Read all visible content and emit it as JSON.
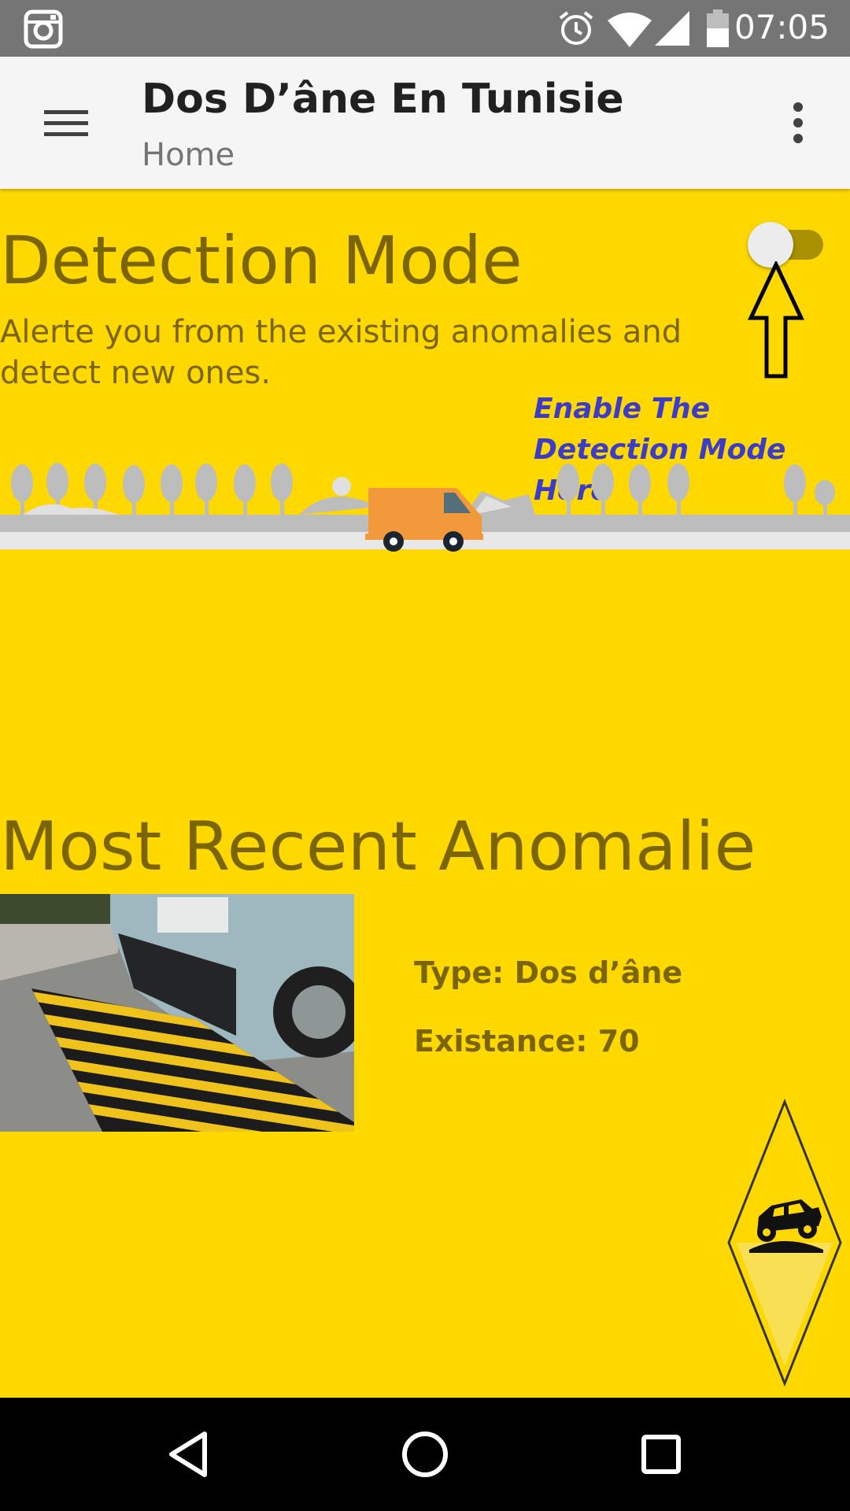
{
  "status_bar": {
    "time": "07:05",
    "icons": [
      "instagram-icon",
      "alarm-icon",
      "wifi-icon",
      "signal-icon",
      "battery-icon"
    ]
  },
  "app_bar": {
    "title": "Dos D’âne En Tunisie",
    "subtitle": "Home",
    "menu_icon": "menu-icon",
    "more_icon": "more-vert-icon"
  },
  "detection": {
    "title": "Detection Mode",
    "description": "Alerte you from the existing anomalies and detect new ones.",
    "toggle_on": false,
    "hint": "Enable The Detection Mode Here"
  },
  "recent": {
    "title": "Most Recent Anomalie",
    "type_text": "Type: Dos d’âne",
    "existance_text": "Existance: 70"
  },
  "nav_bar": {
    "back_icon": "back-icon",
    "home_icon": "home-icon",
    "recents_icon": "recents-icon"
  },
  "colors": {
    "background": "#FFD800",
    "text": "#7A6500",
    "hint": "#3C3CCB",
    "app_bar": "#F5F5F5",
    "status_bar": "#757575"
  }
}
